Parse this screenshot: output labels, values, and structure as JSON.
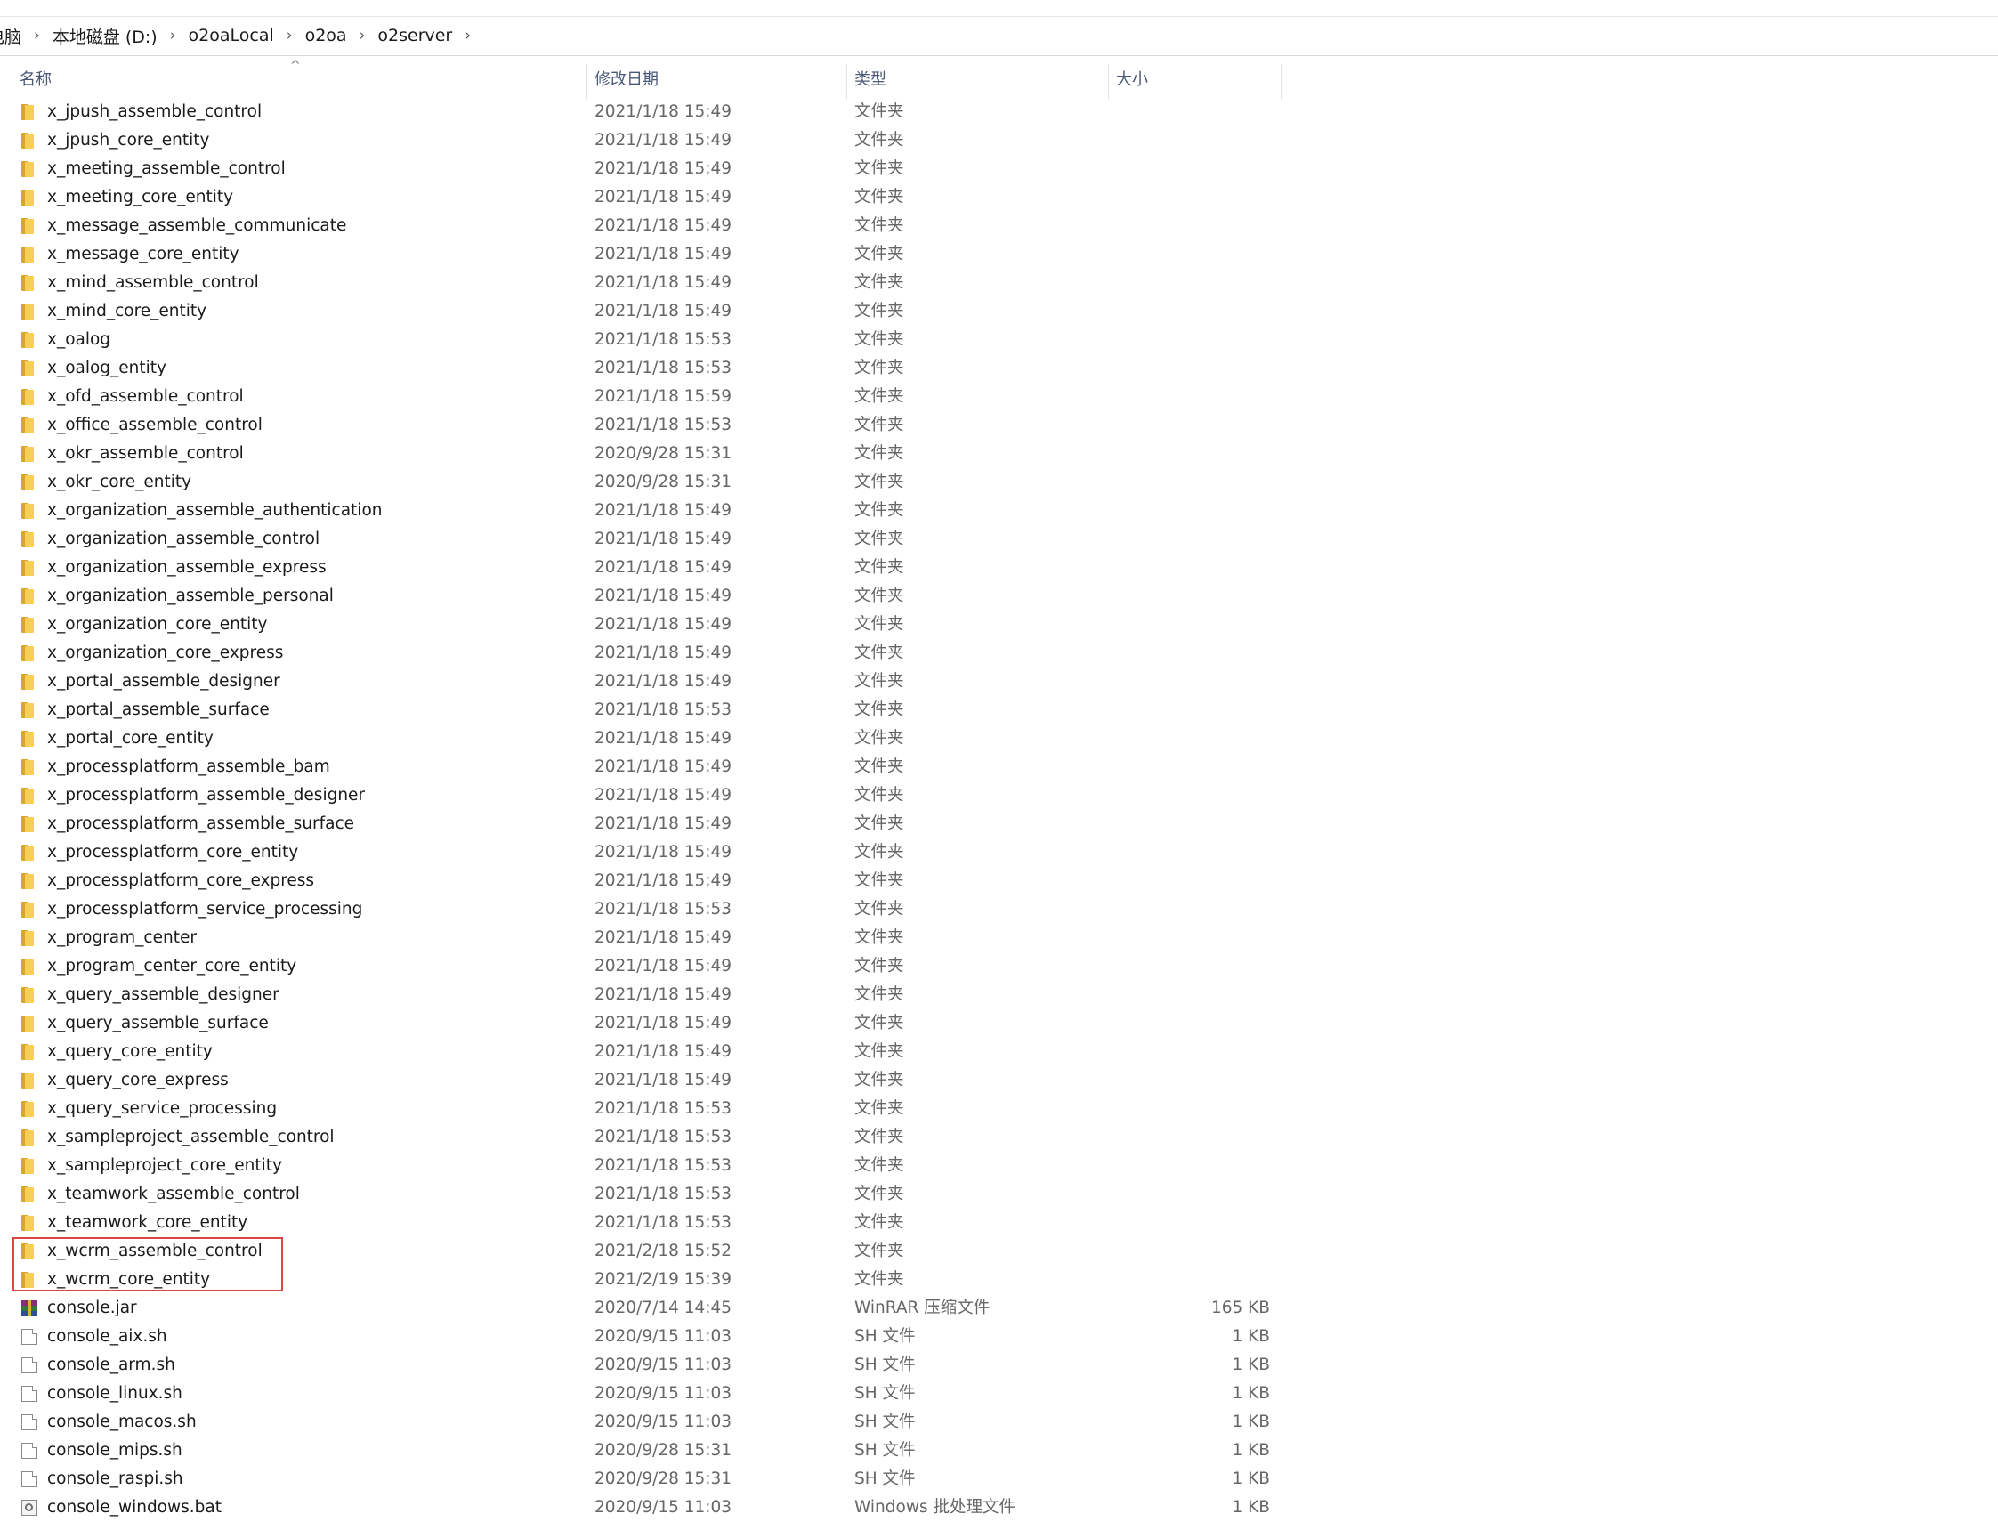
{
  "breadcrumb": {
    "items": [
      "电脑",
      "本地磁盘 (D:)",
      "o2oaLocal",
      "o2oa",
      "o2server"
    ],
    "separator": "›"
  },
  "columns": {
    "name": "名称",
    "date": "修改日期",
    "type": "类型",
    "size": "大小",
    "sort_indicator": "^"
  },
  "files": [
    {
      "name": "x_jpush_assemble_control",
      "date": "2021/1/18 15:49",
      "type": "文件夹",
      "size": "",
      "icon": "folder-icon"
    },
    {
      "name": "x_jpush_core_entity",
      "date": "2021/1/18 15:49",
      "type": "文件夹",
      "size": "",
      "icon": "folder-icon"
    },
    {
      "name": "x_meeting_assemble_control",
      "date": "2021/1/18 15:49",
      "type": "文件夹",
      "size": "",
      "icon": "folder-icon"
    },
    {
      "name": "x_meeting_core_entity",
      "date": "2021/1/18 15:49",
      "type": "文件夹",
      "size": "",
      "icon": "folder-icon"
    },
    {
      "name": "x_message_assemble_communicate",
      "date": "2021/1/18 15:49",
      "type": "文件夹",
      "size": "",
      "icon": "folder-icon"
    },
    {
      "name": "x_message_core_entity",
      "date": "2021/1/18 15:49",
      "type": "文件夹",
      "size": "",
      "icon": "folder-icon"
    },
    {
      "name": "x_mind_assemble_control",
      "date": "2021/1/18 15:49",
      "type": "文件夹",
      "size": "",
      "icon": "folder-icon"
    },
    {
      "name": "x_mind_core_entity",
      "date": "2021/1/18 15:49",
      "type": "文件夹",
      "size": "",
      "icon": "folder-icon"
    },
    {
      "name": "x_oalog",
      "date": "2021/1/18 15:53",
      "type": "文件夹",
      "size": "",
      "icon": "folder-icon"
    },
    {
      "name": "x_oalog_entity",
      "date": "2021/1/18 15:53",
      "type": "文件夹",
      "size": "",
      "icon": "folder-icon"
    },
    {
      "name": "x_ofd_assemble_control",
      "date": "2021/1/18 15:59",
      "type": "文件夹",
      "size": "",
      "icon": "folder-icon"
    },
    {
      "name": "x_office_assemble_control",
      "date": "2021/1/18 15:53",
      "type": "文件夹",
      "size": "",
      "icon": "folder-icon"
    },
    {
      "name": "x_okr_assemble_control",
      "date": "2020/9/28 15:31",
      "type": "文件夹",
      "size": "",
      "icon": "folder-icon"
    },
    {
      "name": "x_okr_core_entity",
      "date": "2020/9/28 15:31",
      "type": "文件夹",
      "size": "",
      "icon": "folder-icon"
    },
    {
      "name": "x_organization_assemble_authentication",
      "date": "2021/1/18 15:49",
      "type": "文件夹",
      "size": "",
      "icon": "folder-icon"
    },
    {
      "name": "x_organization_assemble_control",
      "date": "2021/1/18 15:49",
      "type": "文件夹",
      "size": "",
      "icon": "folder-icon"
    },
    {
      "name": "x_organization_assemble_express",
      "date": "2021/1/18 15:49",
      "type": "文件夹",
      "size": "",
      "icon": "folder-icon"
    },
    {
      "name": "x_organization_assemble_personal",
      "date": "2021/1/18 15:49",
      "type": "文件夹",
      "size": "",
      "icon": "folder-icon"
    },
    {
      "name": "x_organization_core_entity",
      "date": "2021/1/18 15:49",
      "type": "文件夹",
      "size": "",
      "icon": "folder-icon"
    },
    {
      "name": "x_organization_core_express",
      "date": "2021/1/18 15:49",
      "type": "文件夹",
      "size": "",
      "icon": "folder-icon"
    },
    {
      "name": "x_portal_assemble_designer",
      "date": "2021/1/18 15:49",
      "type": "文件夹",
      "size": "",
      "icon": "folder-icon"
    },
    {
      "name": "x_portal_assemble_surface",
      "date": "2021/1/18 15:53",
      "type": "文件夹",
      "size": "",
      "icon": "folder-icon"
    },
    {
      "name": "x_portal_core_entity",
      "date": "2021/1/18 15:49",
      "type": "文件夹",
      "size": "",
      "icon": "folder-icon"
    },
    {
      "name": "x_processplatform_assemble_bam",
      "date": "2021/1/18 15:49",
      "type": "文件夹",
      "size": "",
      "icon": "folder-icon"
    },
    {
      "name": "x_processplatform_assemble_designer",
      "date": "2021/1/18 15:49",
      "type": "文件夹",
      "size": "",
      "icon": "folder-icon"
    },
    {
      "name": "x_processplatform_assemble_surface",
      "date": "2021/1/18 15:49",
      "type": "文件夹",
      "size": "",
      "icon": "folder-icon"
    },
    {
      "name": "x_processplatform_core_entity",
      "date": "2021/1/18 15:49",
      "type": "文件夹",
      "size": "",
      "icon": "folder-icon"
    },
    {
      "name": "x_processplatform_core_express",
      "date": "2021/1/18 15:49",
      "type": "文件夹",
      "size": "",
      "icon": "folder-icon"
    },
    {
      "name": "x_processplatform_service_processing",
      "date": "2021/1/18 15:53",
      "type": "文件夹",
      "size": "",
      "icon": "folder-icon"
    },
    {
      "name": "x_program_center",
      "date": "2021/1/18 15:49",
      "type": "文件夹",
      "size": "",
      "icon": "folder-icon"
    },
    {
      "name": "x_program_center_core_entity",
      "date": "2021/1/18 15:49",
      "type": "文件夹",
      "size": "",
      "icon": "folder-icon"
    },
    {
      "name": "x_query_assemble_designer",
      "date": "2021/1/18 15:49",
      "type": "文件夹",
      "size": "",
      "icon": "folder-icon"
    },
    {
      "name": "x_query_assemble_surface",
      "date": "2021/1/18 15:49",
      "type": "文件夹",
      "size": "",
      "icon": "folder-icon"
    },
    {
      "name": "x_query_core_entity",
      "date": "2021/1/18 15:49",
      "type": "文件夹",
      "size": "",
      "icon": "folder-icon"
    },
    {
      "name": "x_query_core_express",
      "date": "2021/1/18 15:49",
      "type": "文件夹",
      "size": "",
      "icon": "folder-icon"
    },
    {
      "name": "x_query_service_processing",
      "date": "2021/1/18 15:53",
      "type": "文件夹",
      "size": "",
      "icon": "folder-icon"
    },
    {
      "name": "x_sampleproject_assemble_control",
      "date": "2021/1/18 15:53",
      "type": "文件夹",
      "size": "",
      "icon": "folder-icon"
    },
    {
      "name": "x_sampleproject_core_entity",
      "date": "2021/1/18 15:53",
      "type": "文件夹",
      "size": "",
      "icon": "folder-icon"
    },
    {
      "name": "x_teamwork_assemble_control",
      "date": "2021/1/18 15:53",
      "type": "文件夹",
      "size": "",
      "icon": "folder-icon"
    },
    {
      "name": "x_teamwork_core_entity",
      "date": "2021/1/18 15:53",
      "type": "文件夹",
      "size": "",
      "icon": "folder-icon"
    },
    {
      "name": "x_wcrm_assemble_control",
      "date": "2021/2/18 15:52",
      "type": "文件夹",
      "size": "",
      "icon": "folder-icon"
    },
    {
      "name": "x_wcrm_core_entity",
      "date": "2021/2/19 15:39",
      "type": "文件夹",
      "size": "",
      "icon": "folder-icon"
    },
    {
      "name": "console.jar",
      "date": "2020/7/14 14:45",
      "type": "WinRAR 压缩文件",
      "size": "165 KB",
      "icon": "archive-icon"
    },
    {
      "name": "console_aix.sh",
      "date": "2020/9/15 11:03",
      "type": "SH 文件",
      "size": "1 KB",
      "icon": "file-icon"
    },
    {
      "name": "console_arm.sh",
      "date": "2020/9/15 11:03",
      "type": "SH 文件",
      "size": "1 KB",
      "icon": "file-icon"
    },
    {
      "name": "console_linux.sh",
      "date": "2020/9/15 11:03",
      "type": "SH 文件",
      "size": "1 KB",
      "icon": "file-icon"
    },
    {
      "name": "console_macos.sh",
      "date": "2020/9/15 11:03",
      "type": "SH 文件",
      "size": "1 KB",
      "icon": "file-icon"
    },
    {
      "name": "console_mips.sh",
      "date": "2020/9/28 15:31",
      "type": "SH 文件",
      "size": "1 KB",
      "icon": "file-icon"
    },
    {
      "name": "console_raspi.sh",
      "date": "2020/9/28 15:31",
      "type": "SH 文件",
      "size": "1 KB",
      "icon": "file-icon"
    },
    {
      "name": "console_windows.bat",
      "date": "2020/9/15 11:03",
      "type": "Windows 批处理文件",
      "size": "1 KB",
      "icon": "bat-file-icon"
    }
  ],
  "colors": {
    "folder_front": "#f7cf56",
    "folder_back": "#d9a531",
    "highlight_box": "#e0463f",
    "header_text": "#4a5878"
  }
}
